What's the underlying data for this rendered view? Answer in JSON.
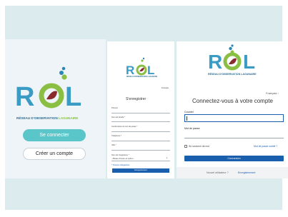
{
  "panel1": {
    "logo_word": "RÖL",
    "tagline_part1": "RÉSEAU D'OBSERVATION ",
    "tagline_part2": "LAGUNAIRE",
    "connect_button": "Se connecter",
    "create_account_button": "Créer un compte"
  },
  "panel2": {
    "logo_word": "RÖL",
    "tagline": "RÉSEAU D'OBSERVATION LAGUNAIRE",
    "language": "Français",
    "title": "S'enregistrer",
    "fields": [
      "Prénom",
      "Nom de famille *",
      "Confirmation du mot de passe *",
      "Téléphone *",
      "Ville *",
      "Nom de l'organisme *"
    ],
    "select_value": "--Please choose an option--",
    "required_note": "* Champs obligatoires",
    "submit": "Enregistrement"
  },
  "panel3": {
    "logo_word": "RÖL",
    "tagline": "RÉSEAU D'OBSERVATION LAGUNAIRE",
    "language": "Français",
    "title": "Connectez-vous à votre compte",
    "email_label": "Courriel",
    "password_label": "Mot de passe",
    "remember_label": "Se souvenir de moi",
    "forgot_link": "Mot de passe oublié ?",
    "login_button": "Connexion",
    "new_user_text": "Nouvel utilisateur ?",
    "register_link": "Enregistrement"
  },
  "colors": {
    "teal": "#5bc6c9",
    "navy_blue": "#1a5fae",
    "logo_blue": "#2a86b5",
    "logo_green": "#8bbf43",
    "wine_red": "#8a2a2e",
    "background": "#dcecee"
  }
}
